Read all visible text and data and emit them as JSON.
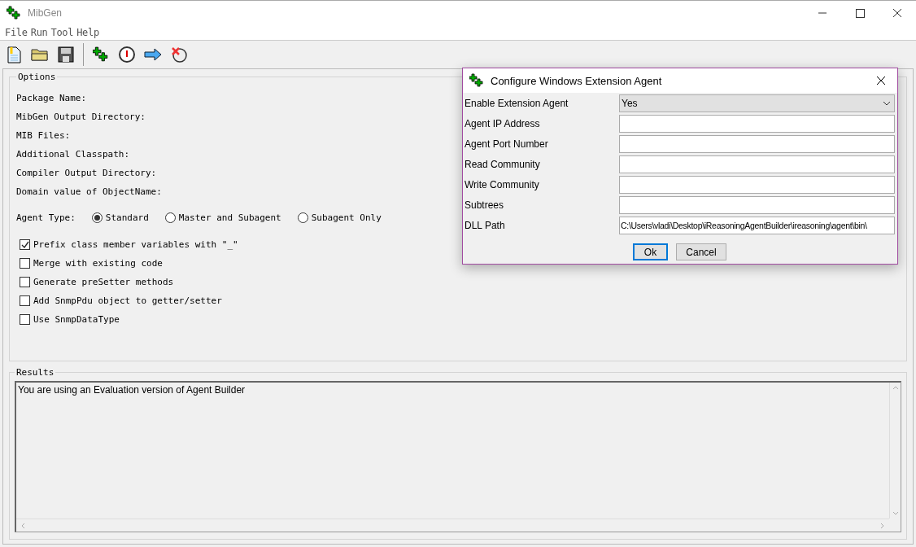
{
  "window": {
    "title": "MibGen"
  },
  "menu": [
    "File",
    "Run",
    "Tool",
    "Help"
  ],
  "options": {
    "title": "Options",
    "labels": [
      "Package Name:",
      "MibGen Output Directory:",
      "MIB Files:",
      "Additional Classpath:",
      "Compiler Output Directory:",
      "Domain value of ObjectName:"
    ],
    "agent_type": {
      "label": "Agent Type:",
      "choices": [
        {
          "label": "Standard",
          "selected": true
        },
        {
          "label": "Master and Subagent",
          "selected": false
        },
        {
          "label": "Subagent Only",
          "selected": false
        }
      ]
    },
    "checkboxes": [
      {
        "label": "Prefix class member variables with \"_\"",
        "checked": true
      },
      {
        "label": "Merge with existing code",
        "checked": false
      },
      {
        "label": "Generate preSetter methods",
        "checked": false
      },
      {
        "label": "Add SnmpPdu object to getter/setter",
        "checked": false
      },
      {
        "label": "Use SnmpDataType",
        "checked": false
      }
    ]
  },
  "results": {
    "title": "Results",
    "text": "You are using an Evaluation version of Agent Builder"
  },
  "dialog": {
    "title": "Configure Windows Extension Agent",
    "fields": [
      {
        "label": "Enable Extension Agent",
        "kind": "dropdown",
        "value": "Yes"
      },
      {
        "label": "Agent IP Address",
        "kind": "text"
      },
      {
        "label": "Agent Port Number",
        "kind": "text"
      },
      {
        "label": "Read Community",
        "kind": "text"
      },
      {
        "label": "Write Community",
        "kind": "text"
      },
      {
        "label": "Subtrees",
        "kind": "text"
      },
      {
        "label": "DLL Path",
        "kind": "text",
        "value": "C:\\Users\\vladi\\Desktop\\iReasoningAgentBuilder\\ireasoning\\agent\\bin\\"
      }
    ],
    "buttons": [
      {
        "label": "Ok",
        "kind": "default"
      },
      {
        "label": "Cancel",
        "kind": "normal"
      }
    ]
  }
}
